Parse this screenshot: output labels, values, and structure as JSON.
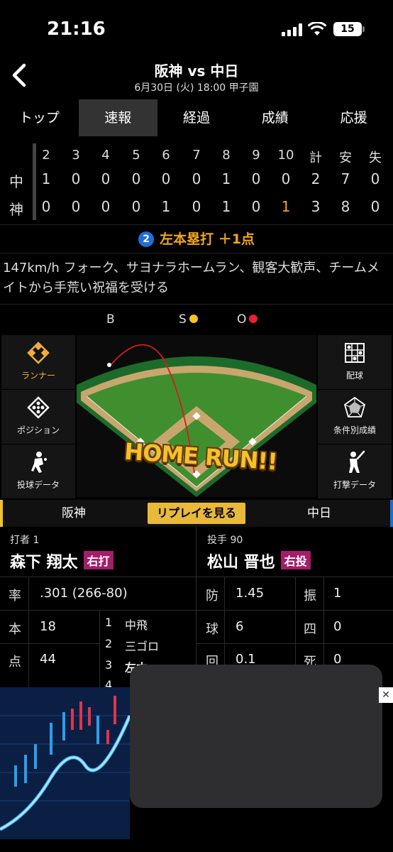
{
  "status": {
    "time": "21:16",
    "battery": "15"
  },
  "header": {
    "title": "阪神 vs 中日",
    "subtitle": "6月30日 (火) 18:00 甲子園"
  },
  "tabs": [
    {
      "label": "トップ",
      "active": false
    },
    {
      "label": "速報",
      "active": true
    },
    {
      "label": "経過",
      "active": false
    },
    {
      "label": "成績",
      "active": false
    },
    {
      "label": "応援",
      "active": false
    }
  ],
  "scoreboard": {
    "headers": [
      "2",
      "3",
      "4",
      "5",
      "6",
      "7",
      "8",
      "9",
      "10",
      "計",
      "安",
      "失"
    ],
    "rows": [
      {
        "team": "中",
        "values": [
          "1",
          "0",
          "0",
          "0",
          "0",
          "0",
          "1",
          "0",
          "0",
          "2",
          "7",
          "0"
        ]
      },
      {
        "team": "神",
        "values": [
          "0",
          "0",
          "0",
          "0",
          "1",
          "0",
          "1",
          "0",
          "1",
          "3",
          "8",
          "0"
        ]
      }
    ],
    "highlight_color": "#f2a51e"
  },
  "play": {
    "number": "2",
    "text": "左本塁打 ＋1点"
  },
  "description": "147km/h フォーク、サヨナラホームラン、観客大歓声、チームメイトから手荒い祝福を受ける",
  "bso": {
    "b": "B",
    "s": "S",
    "o": "O",
    "s_color": "#f5c518",
    "o_color": "#e8212b"
  },
  "left_buttons": [
    {
      "label": "ランナー",
      "icon": "diamond-bases-icon"
    },
    {
      "label": "ポジション",
      "icon": "positions-icon"
    },
    {
      "label": "投球データ",
      "icon": "pitcher-icon"
    }
  ],
  "right_buttons": [
    {
      "label": "配球",
      "icon": "pitch-grid-icon"
    },
    {
      "label": "条件別成績",
      "icon": "radar-chart-icon"
    },
    {
      "label": "打撃データ",
      "icon": "batter-icon"
    }
  ],
  "field": {
    "banner": "HOME RUN!!"
  },
  "bar": {
    "left": "阪神",
    "replay": "リプレイを見る",
    "right": "中日"
  },
  "batter": {
    "label": "打者 1",
    "name": "森下 翔太",
    "hand": "右打",
    "stats": [
      {
        "k": "率",
        "v": ".301 (266-80)"
      },
      {
        "k": "本",
        "v": "18"
      },
      {
        "k": "点",
        "v": "44"
      }
    ],
    "history": [
      {
        "n": "1",
        "r": "中飛"
      },
      {
        "n": "2",
        "r": "三ゴロ"
      },
      {
        "n": "3",
        "r": "左本"
      },
      {
        "n": "4",
        "r": ""
      }
    ]
  },
  "pitcher": {
    "label": "投手 90",
    "name": "松山 晋也",
    "hand": "右投",
    "stats": [
      {
        "k": "防",
        "v": "1.45",
        "k2": "振",
        "v2": "1"
      },
      {
        "k": "球",
        "v": "6",
        "k2": "四",
        "v2": "0"
      },
      {
        "k": "回",
        "v": "0.1",
        "k2": "死",
        "v2": "0"
      }
    ]
  },
  "ad": {
    "close": "✕"
  }
}
